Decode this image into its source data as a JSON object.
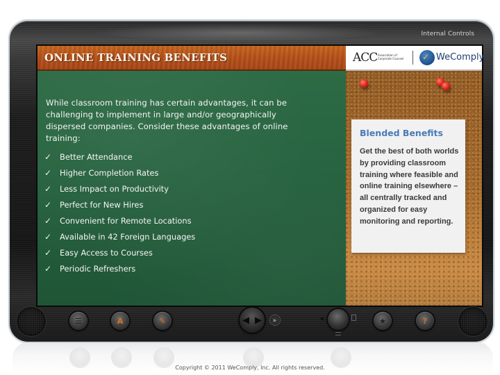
{
  "window": {
    "course_title": "Internal Controls"
  },
  "header": {
    "title": "ONLINE TRAINING BENEFITS",
    "logos": {
      "acc_mark": "ACC",
      "acc_subtitle": "Association of Corporate Counsel",
      "wecomply_text": "WeComply"
    }
  },
  "main": {
    "intro": "While classroom training has certain advantages, it can be challenging to implement in large and/or geographically dispersed companies. Consider these advantages of online training:",
    "check_glyph": "✓",
    "bullets": [
      "Better Attendance",
      "Higher Completion Rates",
      "Less Impact on Productivity",
      "Perfect for New Hires",
      "Convenient for Remote Locations",
      "Available in 42 Foreign Languages",
      "Easy Access to Courses",
      "Periodic Refreshers"
    ]
  },
  "sidebar": {
    "note_title": "Blended Benefits",
    "note_body": "Get the best of both worlds by providing classroom training where feasible and online training elsewhere – all centrally tracked and organized for easy monitoring and reporting."
  },
  "controls": {
    "menu_icon": "☰",
    "glossary_icon": "A",
    "notes_icon": "✎",
    "prev_icon": "◀",
    "next_icon": "▶",
    "play_icon": "▶",
    "volume_icon": "◀",
    "bookmark_icon": "★",
    "help_icon": "?"
  },
  "footer": {
    "copyright": "Copyright © 2011 WeComply, Inc. All rights reserved."
  }
}
